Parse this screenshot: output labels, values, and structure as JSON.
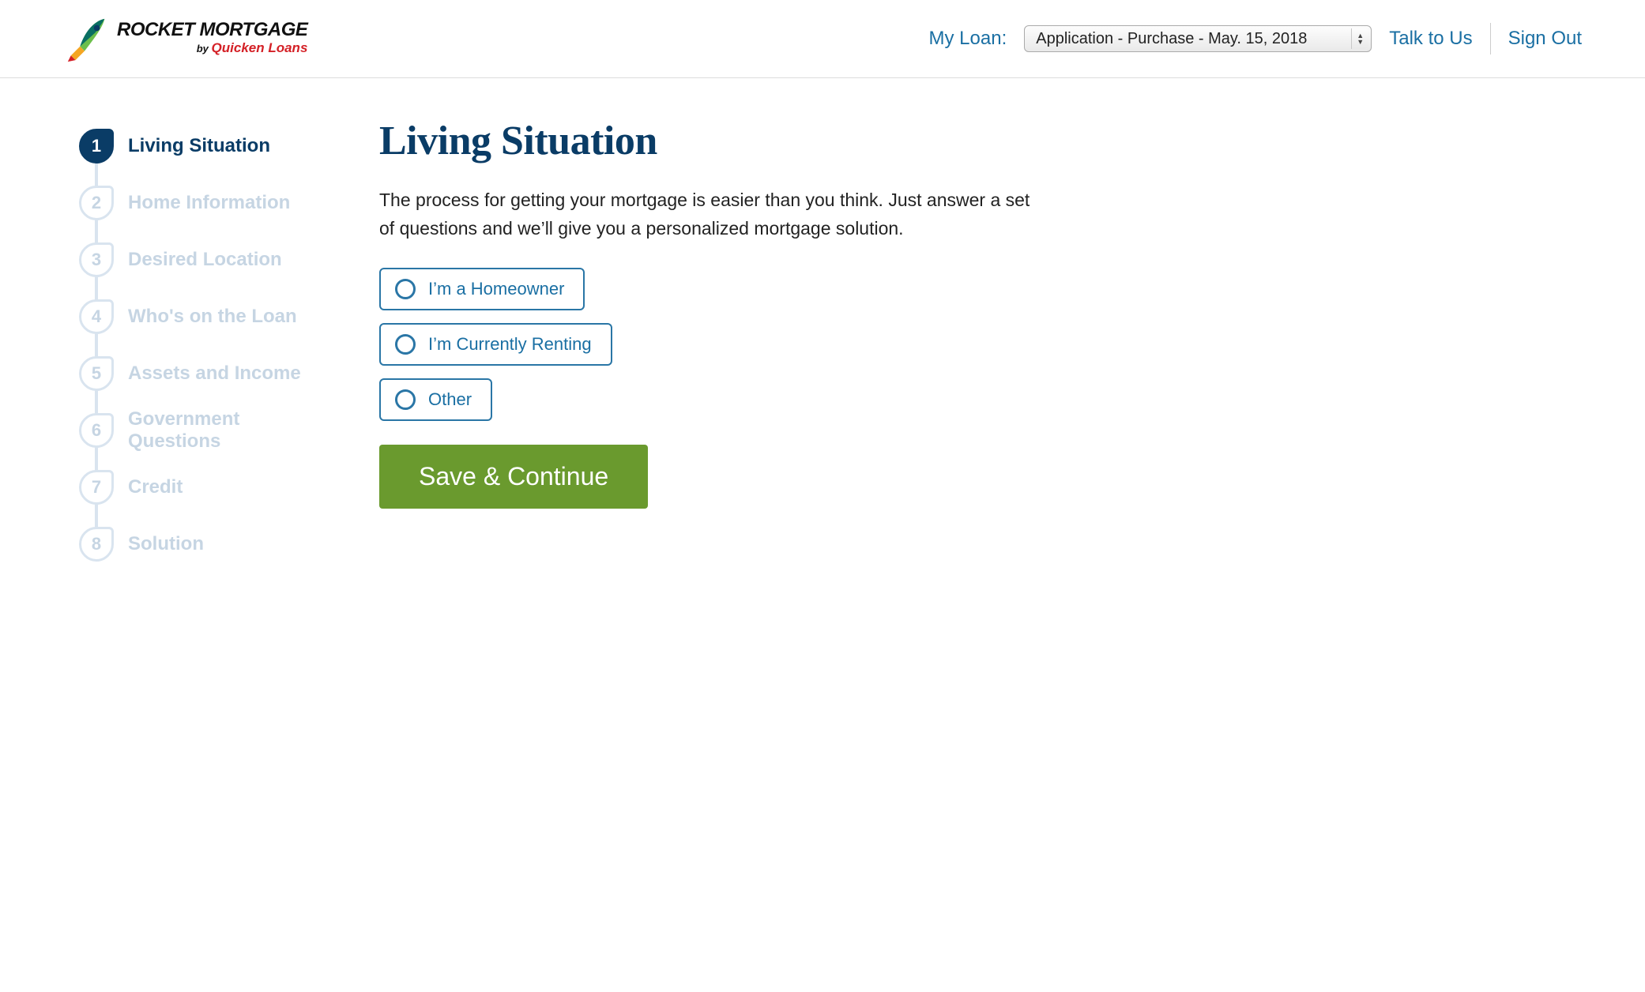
{
  "header": {
    "logo_main": "ROCKET MORTGAGE",
    "logo_by": "by ",
    "logo_sub": "Quicken Loans",
    "myloan_label": "My Loan:",
    "loan_selected": "Application - Purchase - May. 15, 2018",
    "talk_link": "Talk to Us",
    "signout_link": "Sign Out"
  },
  "steps": [
    {
      "num": "1",
      "label": "Living Situation",
      "active": true
    },
    {
      "num": "2",
      "label": "Home Information",
      "active": false
    },
    {
      "num": "3",
      "label": "Desired Location",
      "active": false
    },
    {
      "num": "4",
      "label": "Who's on the Loan",
      "active": false
    },
    {
      "num": "5",
      "label": "Assets and Income",
      "active": false
    },
    {
      "num": "6",
      "label": "Government Questions",
      "active": false
    },
    {
      "num": "7",
      "label": "Credit",
      "active": false
    },
    {
      "num": "8",
      "label": "Solution",
      "active": false
    }
  ],
  "main": {
    "title": "Living Situation",
    "intro": "The process for getting your mortgage is easier than you think. Just answer a set of questions and we’ll give you a personalized mortgage solution.",
    "options": [
      {
        "label": "I’m a Homeowner"
      },
      {
        "label": "I’m Currently Renting"
      },
      {
        "label": "Other"
      }
    ],
    "submit_label": "Save & Continue"
  }
}
